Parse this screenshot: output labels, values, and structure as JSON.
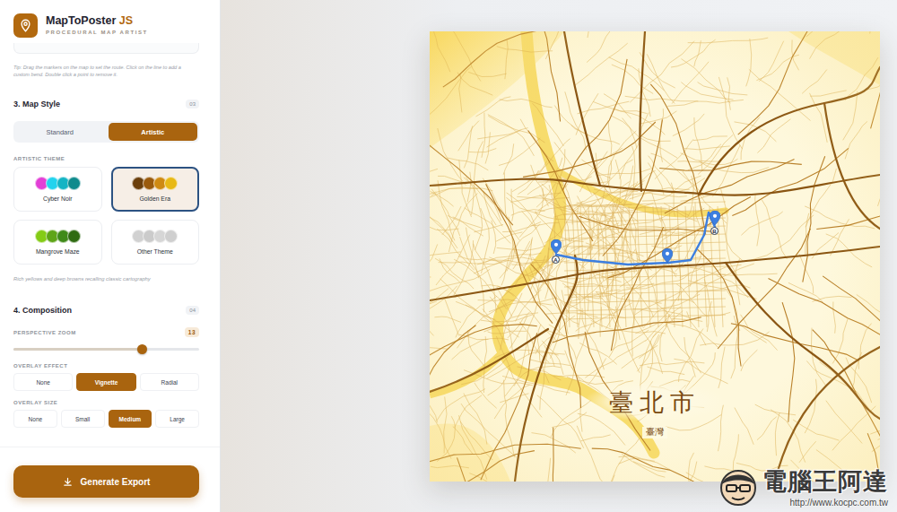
{
  "app": {
    "name": "MapToPoster",
    "name_accent": "JS",
    "tagline": "PROCEDURAL MAP ARTIST"
  },
  "tip": "Tip: Drag the markers on the map to set the route. Click on the line to add a custom bend. Double click a point to remove it.",
  "map_style": {
    "title": "3. Map Style",
    "badge": "03",
    "modes": [
      {
        "label": "Standard",
        "selected": false
      },
      {
        "label": "Artistic",
        "selected": true
      }
    ],
    "theme_label": "ARTISTIC THEME",
    "themes": [
      {
        "name": "Cyber Noir",
        "selected": false,
        "swatches": [
          "#e23fd6",
          "#22d3ee",
          "#14b4c4",
          "#0f8b8d"
        ]
      },
      {
        "name": "Golden Era",
        "selected": true,
        "swatches": [
          "#6b3f0c",
          "#9a5a0c",
          "#cf8a12",
          "#e8b916"
        ]
      },
      {
        "name": "Mangrove Maze",
        "selected": false,
        "swatches": [
          "#84cc16",
          "#5ea517",
          "#3f8a19",
          "#2f6b12"
        ]
      },
      {
        "name": "Other Theme",
        "selected": false,
        "swatches": [
          "#d1d1d1",
          "#cbcbcb",
          "#d6d6d6",
          "#cfcfcf"
        ]
      }
    ],
    "description": "Rich yellows and deep browns recalling classic cartography"
  },
  "composition": {
    "title": "4. Composition",
    "badge": "04",
    "zoom": {
      "label": "PERSPECTIVE ZOOM",
      "reading": "13",
      "level": 0.69
    },
    "overlay_effect": {
      "label": "OVERLAY EFFECT",
      "options": [
        {
          "label": "None",
          "selected": false
        },
        {
          "label": "Vignette",
          "selected": true
        },
        {
          "label": "Radial",
          "selected": false
        }
      ]
    },
    "overlay_size": {
      "label": "OVERLAY SIZE",
      "options": [
        {
          "label": "None",
          "selected": false
        },
        {
          "label": "Small",
          "selected": false
        },
        {
          "label": "Medium",
          "selected": true
        },
        {
          "label": "Large",
          "selected": false
        }
      ]
    }
  },
  "export_button": {
    "label": "Generate Export"
  },
  "poster": {
    "title": "臺北市",
    "subtitle": "臺灣",
    "markers": [
      {
        "kind": "start",
        "label": "A"
      },
      {
        "kind": "waypoint"
      },
      {
        "kind": "end",
        "label": "B"
      }
    ]
  },
  "watermark": {
    "name": "電腦王阿達",
    "url": "http://www.kocpc.com.tw"
  }
}
